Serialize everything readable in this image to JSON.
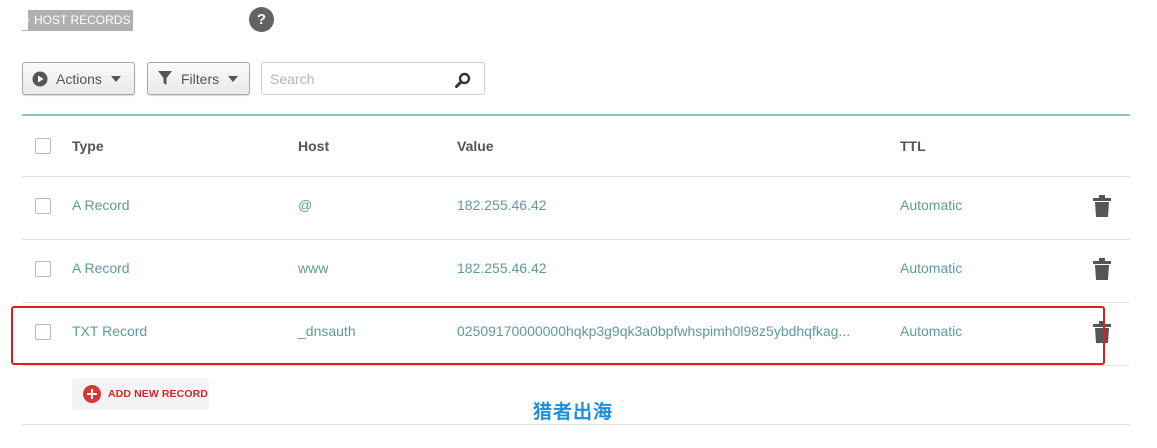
{
  "section": {
    "title": "HOST RECORDS",
    "help_label": "?"
  },
  "toolbar": {
    "actions_label": "Actions",
    "filters_label": "Filters",
    "search_placeholder": "Search",
    "search_value": ""
  },
  "table": {
    "headers": {
      "type": "Type",
      "host": "Host",
      "value": "Value",
      "ttl": "TTL"
    },
    "rows": [
      {
        "type": "A Record",
        "host": "@",
        "value": "182.255.46.42",
        "ttl": "Automatic",
        "checked": false
      },
      {
        "type": "A Record",
        "host": "www",
        "value": "182.255.46.42",
        "ttl": "Automatic",
        "checked": false
      },
      {
        "type": "TXT Record",
        "host": "_dnsauth",
        "value": "02509170000000hqkp3g9qk3a0bpfwhspimh0l98z5ybdhqfkag...",
        "ttl": "Automatic",
        "checked": false,
        "highlighted": true
      }
    ]
  },
  "add_record_label": "ADD NEW RECORD",
  "watermark": "猎者出海",
  "colors": {
    "accent": "#5e9c98",
    "divider": "#8fc5c1",
    "highlight": "#e21d1d",
    "add": "#d93636"
  },
  "icons": {
    "actions": "play-circle-icon",
    "filters": "funnel-icon",
    "search": "magnifier-icon",
    "delete": "trash-icon",
    "add": "plus-circle-icon"
  }
}
